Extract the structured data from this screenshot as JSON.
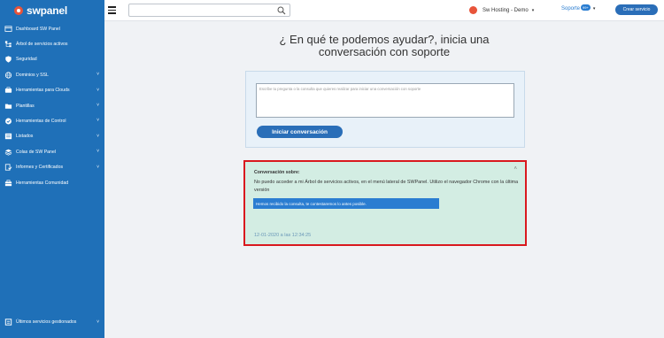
{
  "brand": {
    "name": "swpanel",
    "color": "#1f70b8",
    "accent": "#e8543a"
  },
  "sidebar": {
    "items": [
      {
        "label": "Dashboard SW Panel",
        "icon": "dashboard-icon",
        "chevron": false
      },
      {
        "label": "Árbol de servicios activos",
        "icon": "tree-icon",
        "chevron": false
      },
      {
        "label": "Seguridad",
        "icon": "shield-icon",
        "chevron": false
      },
      {
        "label": "Dominios y SSL",
        "icon": "globe-icon",
        "chevron": true
      },
      {
        "label": "Herramientas para Clouds",
        "icon": "cloud-icon",
        "chevron": true
      },
      {
        "label": "Plantillas",
        "icon": "folder-icon",
        "chevron": true
      },
      {
        "label": "Herramientas de Control",
        "icon": "check-icon",
        "chevron": true
      },
      {
        "label": "Listados",
        "icon": "list-icon",
        "chevron": true
      },
      {
        "label": "Colas de SW Panel",
        "icon": "queue-icon",
        "chevron": true
      },
      {
        "label": "Informes y Certificados",
        "icon": "report-icon",
        "chevron": true
      },
      {
        "label": "Herramientas Comunidad",
        "icon": "toolbox-icon",
        "chevron": false
      }
    ],
    "bottom": {
      "label": "Últimos servicios gestionados",
      "icon": "history-icon"
    },
    "chevron_glyph": "˅"
  },
  "topbar": {
    "search": {
      "placeholder": "",
      "value": ""
    },
    "account": {
      "label": "Sw Hosting - Demo",
      "caret": "▾"
    },
    "support": {
      "label": "Soporte",
      "badge": "99+",
      "caret": "▾"
    },
    "create_button": "Crear servicio"
  },
  "main": {
    "heading_line1": "¿ En qué te podemos ayudar?, inicia una",
    "heading_line2": "conversación con soporte",
    "form": {
      "placeholder": "Escribe tu pregunta o la consulta que quieres realizar para iniciar una conversación con soporte",
      "start_button": "Iniciar conversación"
    },
    "conversation": {
      "title": "Conversación sobre:",
      "collapse_caret": "˄",
      "text": "No puedo acceder a mi Árbol de servicios activos, en el menú lateral de SWPanel. Utilizo el navegador Chrome con la última versión",
      "reply": "Hemos recibido la consulta, te contestaremos lo antes posible.",
      "date": "12-01-2020 a las 12:34:25",
      "highlight_color": "#d9191e"
    }
  }
}
